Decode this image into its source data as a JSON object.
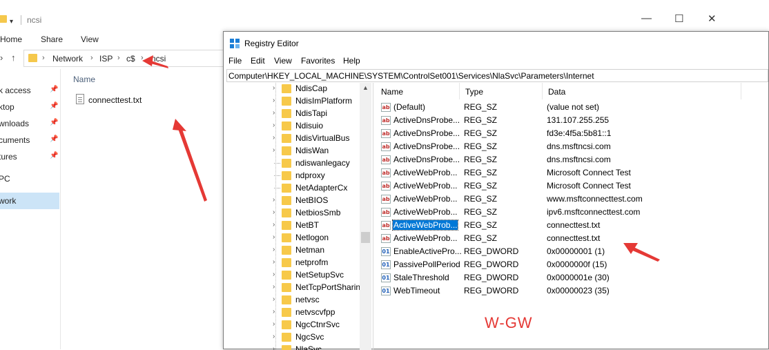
{
  "explorer": {
    "title": "ncsi",
    "ribbon": [
      "Home",
      "Share",
      "View"
    ],
    "breadcrumb": [
      "Network",
      "ISP",
      "c$",
      "ncsi"
    ],
    "nav_items": [
      {
        "label": "k access",
        "pinned": true
      },
      {
        "label": "ktop",
        "pinned": true
      },
      {
        "label": "wnloads",
        "pinned": true
      },
      {
        "label": "cuments",
        "pinned": true
      },
      {
        "label": "tures",
        "pinned": true
      },
      {
        "label": "PC",
        "pinned": false
      },
      {
        "label": "work",
        "pinned": false
      }
    ],
    "column_name": "Name",
    "files": [
      "connecttest.txt"
    ]
  },
  "regedit": {
    "title": "Registry Editor",
    "menu": [
      "File",
      "Edit",
      "View",
      "Favorites",
      "Help"
    ],
    "path": "Computer\\HKEY_LOCAL_MACHINE\\SYSTEM\\ControlSet001\\Services\\NlaSvc\\Parameters\\Internet",
    "tree": [
      {
        "label": "NdisCap",
        "expandable": true
      },
      {
        "label": "NdisImPlatform",
        "expandable": true
      },
      {
        "label": "NdisTapi",
        "expandable": true
      },
      {
        "label": "Ndisuio",
        "expandable": true
      },
      {
        "label": "NdisVirtualBus",
        "expandable": true
      },
      {
        "label": "NdisWan",
        "expandable": true
      },
      {
        "label": "ndiswanlegacy",
        "expandable": false
      },
      {
        "label": "ndproxy",
        "expandable": false
      },
      {
        "label": "NetAdapterCx",
        "expandable": false
      },
      {
        "label": "NetBIOS",
        "expandable": true
      },
      {
        "label": "NetbiosSmb",
        "expandable": true
      },
      {
        "label": "NetBT",
        "expandable": true
      },
      {
        "label": "Netlogon",
        "expandable": true
      },
      {
        "label": "Netman",
        "expandable": true
      },
      {
        "label": "netprofm",
        "expandable": true
      },
      {
        "label": "NetSetupSvc",
        "expandable": true
      },
      {
        "label": "NetTcpPortSharin",
        "expandable": true
      },
      {
        "label": "netvsc",
        "expandable": true
      },
      {
        "label": "netvscvfpp",
        "expandable": true
      },
      {
        "label": "NgcCtnrSvc",
        "expandable": true
      },
      {
        "label": "NgcSvc",
        "expandable": true
      },
      {
        "label": "NlaSvc",
        "expandable": true
      }
    ],
    "columns": [
      "Name",
      "Type",
      "Data"
    ],
    "values": [
      {
        "name": "(Default)",
        "type": "REG_SZ",
        "data": "(value not set)",
        "icon": "ab"
      },
      {
        "name": "ActiveDnsProbe...",
        "type": "REG_SZ",
        "data": "131.107.255.255",
        "icon": "ab"
      },
      {
        "name": "ActiveDnsProbe...",
        "type": "REG_SZ",
        "data": "fd3e:4f5a:5b81::1",
        "icon": "ab"
      },
      {
        "name": "ActiveDnsProbe...",
        "type": "REG_SZ",
        "data": "dns.msftncsi.com",
        "icon": "ab"
      },
      {
        "name": "ActiveDnsProbe...",
        "type": "REG_SZ",
        "data": "dns.msftncsi.com",
        "icon": "ab"
      },
      {
        "name": "ActiveWebProb...",
        "type": "REG_SZ",
        "data": "Microsoft Connect Test",
        "icon": "ab"
      },
      {
        "name": "ActiveWebProb...",
        "type": "REG_SZ",
        "data": "Microsoft Connect Test",
        "icon": "ab"
      },
      {
        "name": "ActiveWebProb...",
        "type": "REG_SZ",
        "data": "www.msftconnecttest.com",
        "icon": "ab"
      },
      {
        "name": "ActiveWebProb...",
        "type": "REG_SZ",
        "data": "ipv6.msftconnecttest.com",
        "icon": "ab"
      },
      {
        "name": "ActiveWebProb...",
        "type": "REG_SZ",
        "data": "connecttest.txt",
        "icon": "ab",
        "selected": true
      },
      {
        "name": "ActiveWebProb...",
        "type": "REG_SZ",
        "data": "connecttest.txt",
        "icon": "ab"
      },
      {
        "name": "EnableActivePro...",
        "type": "REG_DWORD",
        "data": "0x00000001 (1)",
        "icon": "dw"
      },
      {
        "name": "PassivePollPeriod",
        "type": "REG_DWORD",
        "data": "0x0000000f (15)",
        "icon": "dw"
      },
      {
        "name": "StaleThreshold",
        "type": "REG_DWORD",
        "data": "0x0000001e (30)",
        "icon": "dw"
      },
      {
        "name": "WebTimeout",
        "type": "REG_DWORD",
        "data": "0x00000023 (35)",
        "icon": "dw"
      }
    ]
  },
  "watermark": "W-GW",
  "colors": {
    "annotation": "#e53935",
    "selection": "#0078d7"
  }
}
